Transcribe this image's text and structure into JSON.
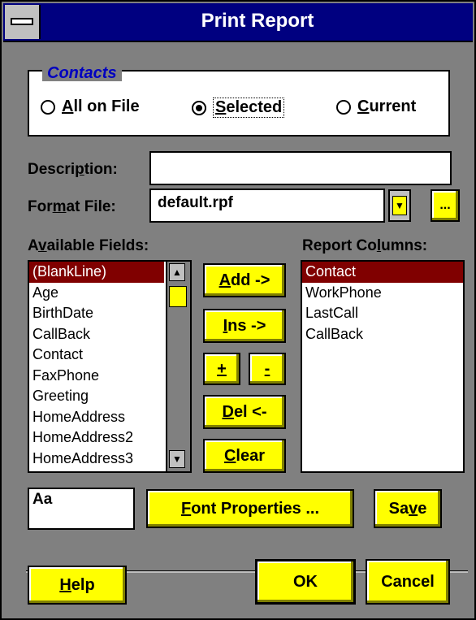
{
  "window": {
    "title": "Print Report"
  },
  "contacts_group": {
    "legend": "Contacts",
    "options": [
      {
        "mnemonic": "A",
        "rest": "ll on File",
        "checked": false
      },
      {
        "mnemonic": "S",
        "rest": "elected",
        "checked": true
      },
      {
        "mnemonic": "C",
        "rest": "urrent",
        "checked": false
      }
    ]
  },
  "description": {
    "label_pre": "Descri",
    "label_mnemonic": "p",
    "label_post": "tion:",
    "value": ""
  },
  "format_file": {
    "label_pre": "For",
    "label_mnemonic": "m",
    "label_post": "at File:",
    "value": "default.rpf",
    "dropdown_glyph": "▼",
    "browse_label": "..."
  },
  "available_fields": {
    "label_pre": "A",
    "label_mnemonic": "v",
    "label_post": "ailable Fields:",
    "items": [
      "(BlankLine)",
      "Age",
      "BirthDate",
      "CallBack",
      "Contact",
      "FaxPhone",
      "Greeting",
      "HomeAddress",
      "HomeAddress2",
      "HomeAddress3"
    ],
    "selected_index": 0,
    "scroll_up": "▲",
    "scroll_down": "▼"
  },
  "report_columns": {
    "label_pre": "Report Co",
    "label_mnemonic": "l",
    "label_post": "umns:",
    "items": [
      "Contact",
      "WorkPhone",
      "LastCall",
      "CallBack"
    ],
    "selected_index": 0
  },
  "buttons": {
    "add": {
      "mnemonic": "A",
      "rest": "dd ->"
    },
    "ins": {
      "mnemonic": "I",
      "rest": "ns ->"
    },
    "plus": {
      "mnemonic": "+",
      "rest": ""
    },
    "minus": {
      "mnemonic": "-",
      "rest": ""
    },
    "del": {
      "mnemonic": "D",
      "rest": "el <-"
    },
    "clear": {
      "mnemonic": "C",
      "rest": "lear"
    },
    "font_properties": {
      "mnemonic": "F",
      "rest": "ont Properties ..."
    },
    "save": {
      "pre": "Sa",
      "mnemonic": "v",
      "post": "e"
    },
    "help": {
      "mnemonic": "H",
      "rest": "elp"
    },
    "ok": "OK",
    "cancel": "Cancel"
  },
  "font_preview": {
    "sample": "Aa"
  },
  "colors": {
    "titlebar": "#000080",
    "dialog_bg": "#808080",
    "button_face": "#ffff00",
    "selection": "#800000",
    "legend_text": "#0000c0"
  }
}
